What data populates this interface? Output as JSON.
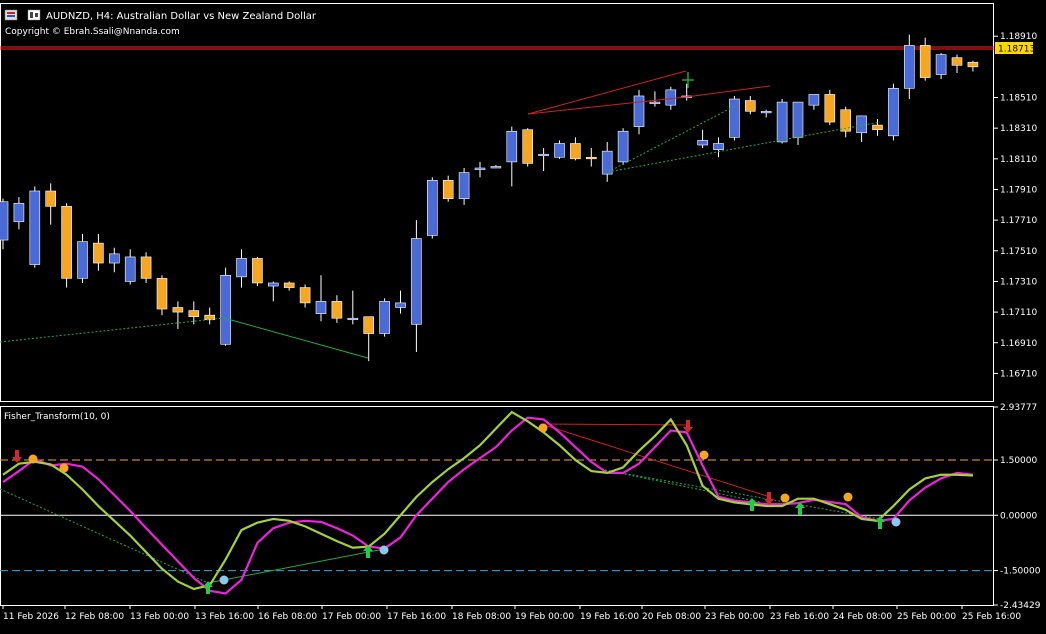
{
  "header": {
    "symbol_line": "AUDNZD, H4:  Australian Dollar vs New Zealand Dollar",
    "copyright": "Copyright © Ebrah.Ssali@Nnanda.com"
  },
  "indicator": {
    "name": "Fisher_Transform(10, 0)"
  },
  "colors": {
    "background": "#000000",
    "bull": "#4a6ad6",
    "bear": "#f5a623",
    "price_line": "#ff2020",
    "fisher_main": "#ee22dd",
    "fisher_signal": "#a4d13a",
    "level_upper": "#f5a623",
    "level_lower": "#2aa9e0",
    "arrow_up": "#22cc44",
    "arrow_down": "#cc2a2a"
  },
  "chart_data": [
    {
      "type": "candlestick",
      "title": "AUDNZD, H4",
      "current_price": "1.18713",
      "y_ticks": [
        "1.18910",
        "1.18510",
        "1.18310",
        "1.18110",
        "1.17910",
        "1.17710",
        "1.17510",
        "1.17310",
        "1.17110",
        "1.16910",
        "1.16710"
      ],
      "x_ticks": [
        "11 Feb 2026",
        "12 Feb 08:00",
        "13 Feb 00:00",
        "13 Feb 16:00",
        "16 Feb 08:00",
        "17 Feb 00:00",
        "17 Feb 16:00",
        "18 Feb 08:00",
        "19 Feb 00:00",
        "19 Feb 16:00",
        "20 Feb 08:00",
        "23 Feb 00:00",
        "23 Feb 16:00",
        "24 Feb 08:00",
        "25 Feb 00:00",
        "25 Feb 16:00"
      ],
      "ylim": [
        1.1653,
        1.1912
      ],
      "candles": [
        {
          "o": 1.1758,
          "h": 1.1785,
          "l": 1.1752,
          "c": 1.1783
        },
        {
          "o": 1.177,
          "h": 1.1786,
          "l": 1.1765,
          "c": 1.1782
        },
        {
          "o": 1.1742,
          "h": 1.1793,
          "l": 1.174,
          "c": 1.179
        },
        {
          "o": 1.179,
          "h": 1.1795,
          "l": 1.1768,
          "c": 1.178
        },
        {
          "o": 1.178,
          "h": 1.1782,
          "l": 1.1727,
          "c": 1.1733
        },
        {
          "o": 1.1733,
          "h": 1.1762,
          "l": 1.173,
          "c": 1.1757
        },
        {
          "o": 1.1756,
          "h": 1.1762,
          "l": 1.1738,
          "c": 1.1743
        },
        {
          "o": 1.1743,
          "h": 1.1753,
          "l": 1.1737,
          "c": 1.1749
        },
        {
          "o": 1.1731,
          "h": 1.1752,
          "l": 1.1729,
          "c": 1.1747
        },
        {
          "o": 1.1747,
          "h": 1.175,
          "l": 1.173,
          "c": 1.1733
        },
        {
          "o": 1.1733,
          "h": 1.1735,
          "l": 1.1709,
          "c": 1.1713
        },
        {
          "o": 1.1714,
          "h": 1.1718,
          "l": 1.17,
          "c": 1.1711
        },
        {
          "o": 1.1712,
          "h": 1.1718,
          "l": 1.1703,
          "c": 1.1708
        },
        {
          "o": 1.1709,
          "h": 1.1714,
          "l": 1.1703,
          "c": 1.1706
        },
        {
          "o": 1.169,
          "h": 1.174,
          "l": 1.1689,
          "c": 1.1735
        },
        {
          "o": 1.1734,
          "h": 1.1752,
          "l": 1.1727,
          "c": 1.1746
        },
        {
          "o": 1.1746,
          "h": 1.1747,
          "l": 1.1728,
          "c": 1.173
        },
        {
          "o": 1.1728,
          "h": 1.1731,
          "l": 1.1718,
          "c": 1.173
        },
        {
          "o": 1.173,
          "h": 1.1731,
          "l": 1.1725,
          "c": 1.1727
        },
        {
          "o": 1.1727,
          "h": 1.1729,
          "l": 1.1714,
          "c": 1.1717
        },
        {
          "o": 1.171,
          "h": 1.1735,
          "l": 1.1705,
          "c": 1.1718
        },
        {
          "o": 1.1718,
          "h": 1.1722,
          "l": 1.1704,
          "c": 1.1707
        },
        {
          "o": 1.1707,
          "h": 1.1725,
          "l": 1.1703,
          "c": 1.1707
        },
        {
          "o": 1.1708,
          "h": 1.1708,
          "l": 1.1679,
          "c": 1.1697
        },
        {
          "o": 1.1697,
          "h": 1.172,
          "l": 1.1695,
          "c": 1.1718
        },
        {
          "o": 1.1714,
          "h": 1.1725,
          "l": 1.171,
          "c": 1.1717
        },
        {
          "o": 1.1703,
          "h": 1.1771,
          "l": 1.1685,
          "c": 1.1759
        },
        {
          "o": 1.1761,
          "h": 1.1799,
          "l": 1.1759,
          "c": 1.1797
        },
        {
          "o": 1.1797,
          "h": 1.18,
          "l": 1.1783,
          "c": 1.1785
        },
        {
          "o": 1.1785,
          "h": 1.1805,
          "l": 1.1781,
          "c": 1.1802
        },
        {
          "o": 1.1804,
          "h": 1.1809,
          "l": 1.1799,
          "c": 1.1805
        },
        {
          "o": 1.1805,
          "h": 1.1807,
          "l": 1.1806,
          "c": 1.1806
        },
        {
          "o": 1.1809,
          "h": 1.1832,
          "l": 1.1793,
          "c": 1.1829
        },
        {
          "o": 1.183,
          "h": 1.1831,
          "l": 1.1806,
          "c": 1.1808
        },
        {
          "o": 1.1813,
          "h": 1.1818,
          "l": 1.1803,
          "c": 1.1814
        },
        {
          "o": 1.1812,
          "h": 1.1823,
          "l": 1.1811,
          "c": 1.1821
        },
        {
          "o": 1.1821,
          "h": 1.1825,
          "l": 1.181,
          "c": 1.1811
        },
        {
          "o": 1.1812,
          "h": 1.1818,
          "l": 1.1806,
          "c": 1.1811
        },
        {
          "o": 1.1801,
          "h": 1.1822,
          "l": 1.1796,
          "c": 1.1816
        },
        {
          "o": 1.1809,
          "h": 1.1831,
          "l": 1.1807,
          "c": 1.1829
        },
        {
          "o": 1.1832,
          "h": 1.1856,
          "l": 1.1827,
          "c": 1.1852
        },
        {
          "o": 1.1847,
          "h": 1.1855,
          "l": 1.1845,
          "c": 1.1848
        },
        {
          "o": 1.1846,
          "h": 1.1858,
          "l": 1.1843,
          "c": 1.1856
        },
        {
          "o": 1.1852,
          "h": 1.186,
          "l": 1.1849,
          "c": 1.1852
        },
        {
          "o": 1.182,
          "h": 1.183,
          "l": 1.1818,
          "c": 1.1823
        },
        {
          "o": 1.1817,
          "h": 1.1825,
          "l": 1.1812,
          "c": 1.1821
        },
        {
          "o": 1.1825,
          "h": 1.1852,
          "l": 1.1823,
          "c": 1.185
        },
        {
          "o": 1.1849,
          "h": 1.1852,
          "l": 1.184,
          "c": 1.1842
        },
        {
          "o": 1.1841,
          "h": 1.1843,
          "l": 1.1838,
          "c": 1.1842
        },
        {
          "o": 1.1822,
          "h": 1.185,
          "l": 1.1821,
          "c": 1.1848
        },
        {
          "o": 1.1825,
          "h": 1.1848,
          "l": 1.182,
          "c": 1.1848
        },
        {
          "o": 1.1846,
          "h": 1.1852,
          "l": 1.1843,
          "c": 1.1853
        },
        {
          "o": 1.1853,
          "h": 1.1856,
          "l": 1.1833,
          "c": 1.1835
        },
        {
          "o": 1.1843,
          "h": 1.1845,
          "l": 1.1825,
          "c": 1.1829
        },
        {
          "o": 1.1828,
          "h": 1.1838,
          "l": 1.1822,
          "c": 1.1839
        },
        {
          "o": 1.1833,
          "h": 1.1837,
          "l": 1.1826,
          "c": 1.183
        },
        {
          "o": 1.1826,
          "h": 1.186,
          "l": 1.1823,
          "c": 1.1857
        },
        {
          "o": 1.1857,
          "h": 1.1892,
          "l": 1.185,
          "c": 1.1885
        },
        {
          "o": 1.1885,
          "h": 1.189,
          "l": 1.1862,
          "c": 1.1864
        },
        {
          "o": 1.1866,
          "h": 1.188,
          "l": 1.1863,
          "c": 1.1879
        },
        {
          "o": 1.1877,
          "h": 1.1879,
          "l": 1.1867,
          "c": 1.1872
        },
        {
          "o": 1.1874,
          "h": 1.1875,
          "l": 1.1868,
          "c": 1.1871
        }
      ]
    },
    {
      "type": "line",
      "title": "Fisher_Transform(10, 0)",
      "y_ticks": [
        "2.93777",
        "1.50000",
        "0.00000",
        "-1.50000",
        "-2.43429"
      ],
      "ylim": [
        -2.43429,
        2.93777
      ],
      "levels": [
        1.5,
        0,
        -1.5
      ],
      "series": [
        {
          "values": [
            0.9,
            1.2,
            1.52,
            1.35,
            1.4,
            1.32,
            0.98,
            0.55,
            0.12,
            -0.35,
            -0.8,
            -1.25,
            -1.7,
            -2.05,
            -2.12,
            -1.75,
            -0.75,
            -0.35,
            -0.2,
            -0.15,
            -0.18,
            -0.35,
            -0.55,
            -0.85,
            -0.9,
            -0.6,
            0.0,
            0.45,
            0.9,
            1.25,
            1.55,
            1.85,
            2.3,
            2.65,
            2.6,
            2.25,
            1.85,
            1.45,
            1.15,
            1.15,
            1.4,
            1.85,
            2.3,
            2.25,
            1.35,
            0.5,
            0.4,
            0.35,
            0.3,
            0.3,
            0.33,
            0.42,
            0.36,
            0.3,
            -0.05,
            -0.15,
            -0.1,
            0.4,
            0.75,
            1.0,
            1.15,
            1.1
          ]
        },
        {
          "values": [
            1.1,
            1.4,
            1.45,
            1.38,
            1.1,
            0.7,
            0.25,
            -0.15,
            -0.55,
            -1.0,
            -1.45,
            -1.8,
            -2.0,
            -1.9,
            -1.2,
            -0.4,
            -0.2,
            -0.1,
            -0.15,
            -0.3,
            -0.5,
            -0.7,
            -0.88,
            -0.85,
            -0.5,
            0.0,
            0.5,
            0.9,
            1.25,
            1.55,
            1.9,
            2.35,
            2.8,
            2.55,
            2.25,
            1.9,
            1.5,
            1.2,
            1.15,
            1.3,
            1.75,
            2.15,
            2.6,
            1.9,
            0.8,
            0.45,
            0.35,
            0.3,
            0.25,
            0.25,
            0.45,
            0.45,
            0.3,
            0.15,
            -0.1,
            -0.15,
            0.25,
            0.7,
            1.0,
            1.1,
            1.1,
            1.08
          ]
        }
      ]
    }
  ]
}
